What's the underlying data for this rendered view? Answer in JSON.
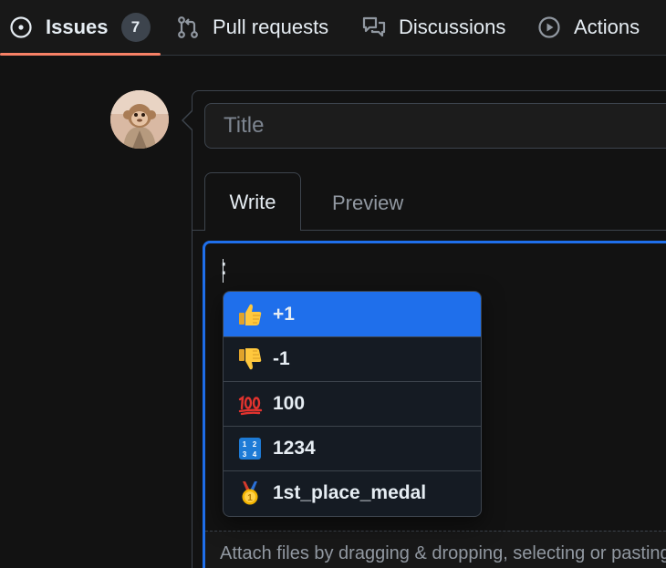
{
  "nav": {
    "issues": {
      "label": "Issues",
      "count": "7"
    },
    "pulls": {
      "label": "Pull requests"
    },
    "discussions": {
      "label": "Discussions"
    },
    "actions": {
      "label": "Actions"
    }
  },
  "form": {
    "title_placeholder": "Title",
    "tabs": {
      "write": "Write",
      "preview": "Preview"
    },
    "editor_text": ":",
    "attach_text": "Attach files by dragging & dropping, selecting or pasting them."
  },
  "emoji_suggestions": [
    {
      "icon": "thumbs-up-icon",
      "label": "+1",
      "selected": true
    },
    {
      "icon": "thumbs-down-icon",
      "label": "-1",
      "selected": false
    },
    {
      "icon": "hundred-points-icon",
      "label": "100",
      "selected": false
    },
    {
      "icon": "input-numbers-icon",
      "label": "1234",
      "selected": false
    },
    {
      "icon": "first-place-medal-icon",
      "label": "1st_place_medal",
      "selected": false
    }
  ],
  "colors": {
    "accent": "#1f6feb",
    "underline": "#f78166"
  }
}
